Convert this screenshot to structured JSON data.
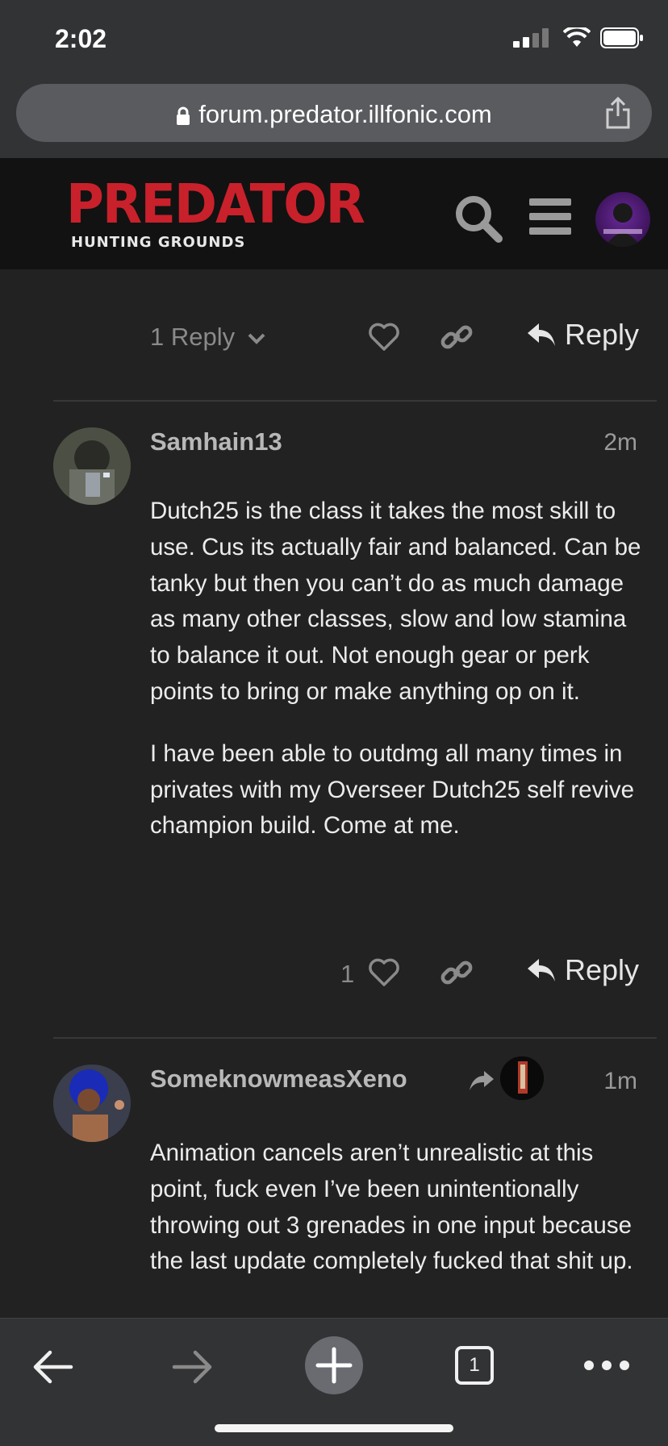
{
  "status_bar": {
    "time": "2:02"
  },
  "browser": {
    "url": "forum.predator.illfonic.com"
  },
  "site_header": {
    "logo_title": "PREDATOR",
    "logo_subtitle": "HUNTING GROUNDS"
  },
  "previous_post_actions": {
    "replies_toggle": "1 Reply",
    "reply_label": "Reply"
  },
  "posts": [
    {
      "username": "Samhain13",
      "time": "2m",
      "paragraphs": [
        "Dutch25 is the class it takes the most skill to use. Cus its actually fair and balanced. Can be tanky but then you can’t do as much damage as many other classes, slow and low stamina to balance it out. Not enough gear or perk points to bring or make anything op on it.",
        "I have been able to outdmg all many times in privates with my Overseer Dutch25 self revive champion build. Come at me."
      ],
      "like_count": "1",
      "reply_label": "Reply"
    },
    {
      "username": "SomeknowmeasXeno",
      "time": "1m",
      "paragraphs": [
        "Animation cancels aren’t unrealistic at this point, fuck even I’ve been unintentionally throwing out 3 grenades in one input because the last update completely fucked that shit up."
      ]
    }
  ],
  "toolbar": {
    "tab_count": "1"
  },
  "colors": {
    "background": "#222222",
    "logo_red": "#c8212b",
    "chrome": "#323335"
  }
}
